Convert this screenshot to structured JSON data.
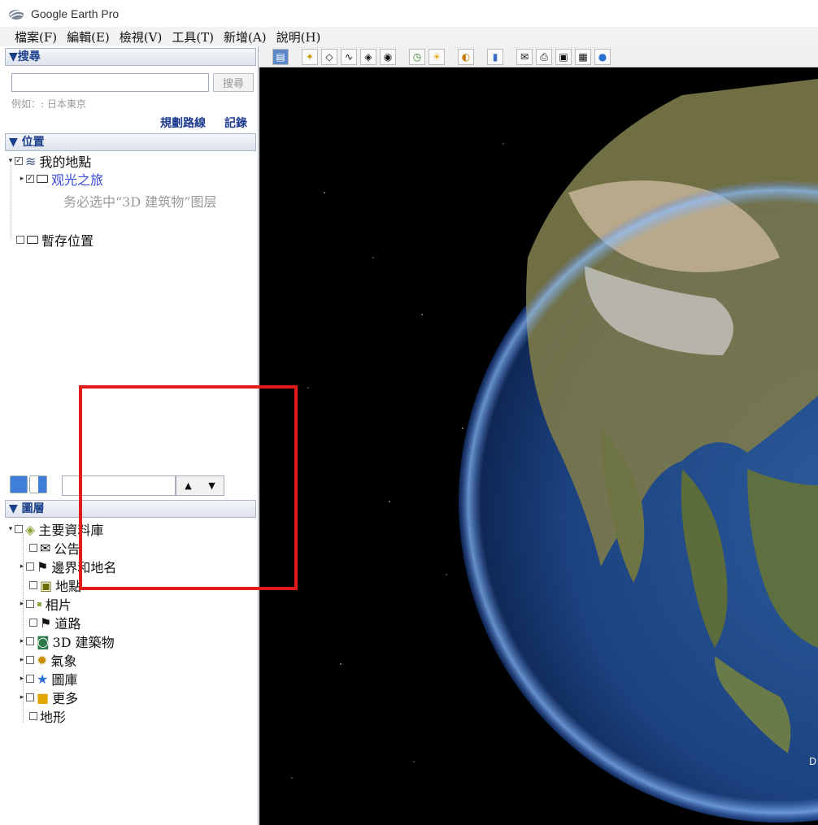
{
  "window": {
    "title": "Google Earth Pro"
  },
  "menu": [
    "檔案(F)",
    "編輯(E)",
    "檢視(V)",
    "工具(T)",
    "新增(A)",
    "說明(H)"
  ],
  "search": {
    "header": "▼搜尋",
    "button": "搜尋",
    "hint": "例如：: 日本東京",
    "route_link": "規劃路線",
    "history_link": "記錄"
  },
  "places": {
    "header": "▼ 位置",
    "items": [
      {
        "label": "我的地點"
      },
      {
        "label": "观光之旅"
      },
      {
        "label": "务必选中“3D 建筑物”图层"
      },
      {
        "label": "暫存位置"
      }
    ]
  },
  "layers": {
    "header": "▼ 圖層",
    "items": [
      {
        "label": "主要資料庫"
      },
      {
        "label": "公告"
      },
      {
        "label": "邊界和地名"
      },
      {
        "label": "地點"
      },
      {
        "label": "相片"
      },
      {
        "label": "道路"
      },
      {
        "label": "3D 建築物"
      },
      {
        "label": "氣象"
      },
      {
        "label": "圖庫"
      },
      {
        "label": "更多"
      },
      {
        "label": "地形"
      }
    ]
  },
  "map": {
    "corner_letter": "D"
  },
  "colors": {
    "highlight_box": "#e21b1b",
    "link": "#1f3c90",
    "header_text": "#1a3f8a"
  }
}
